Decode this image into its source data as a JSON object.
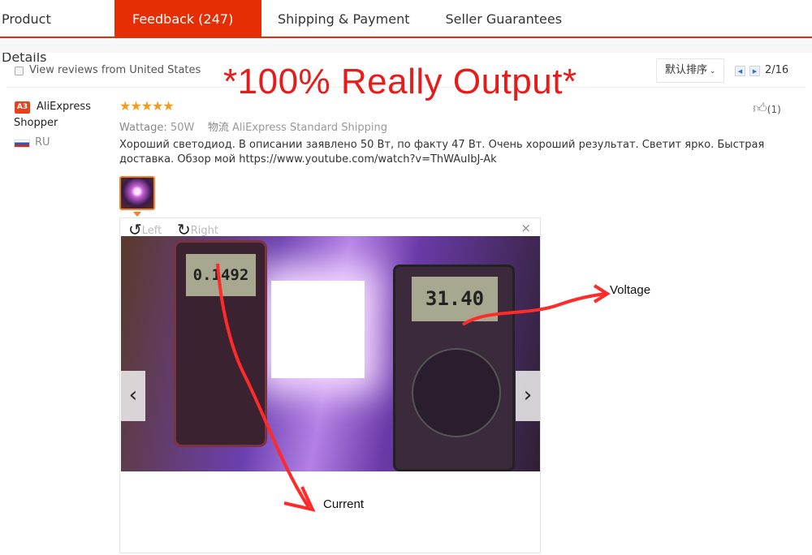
{
  "tabs": [
    {
      "label": "Product Details"
    },
    {
      "label": "Feedback (247)",
      "active": true
    },
    {
      "label": "Shipping & Payment"
    },
    {
      "label": "Seller Guarantees"
    }
  ],
  "toolbar": {
    "view_us_label": "View reviews from United States",
    "sort_value": "默认排序",
    "page": "2/16"
  },
  "banner": "*100% Really Output*",
  "review": {
    "badge": "A3",
    "user": "AliExpress Shopper",
    "country": "RU",
    "rating": 5,
    "stars": "★★★★★",
    "attr_label": "Wattage:",
    "attr_value": "50W",
    "ship_label": "物流",
    "ship_value": "AliExpress Standard Shipping",
    "text": "Хороший светодиод. В описании заявлено 50 Вт, по факту 47 Вт. Очень хороший результат. Светит ярко. Быстрая доставка. Обзор мой https://www.youtube.com/watch?v=ThWAuIbJ-Ak",
    "likes": "(1)"
  },
  "viewer": {
    "rotate_left": "Left",
    "rotate_right": "Right",
    "close": "×",
    "meter1_reading": "0.1492",
    "meter2_reading": "31.40",
    "annotation_voltage": "Voltage",
    "annotation_current": "Current"
  },
  "colors": {
    "accent": "#e62e04",
    "stars": "#f59c1c",
    "banner": "#e81b1b"
  }
}
